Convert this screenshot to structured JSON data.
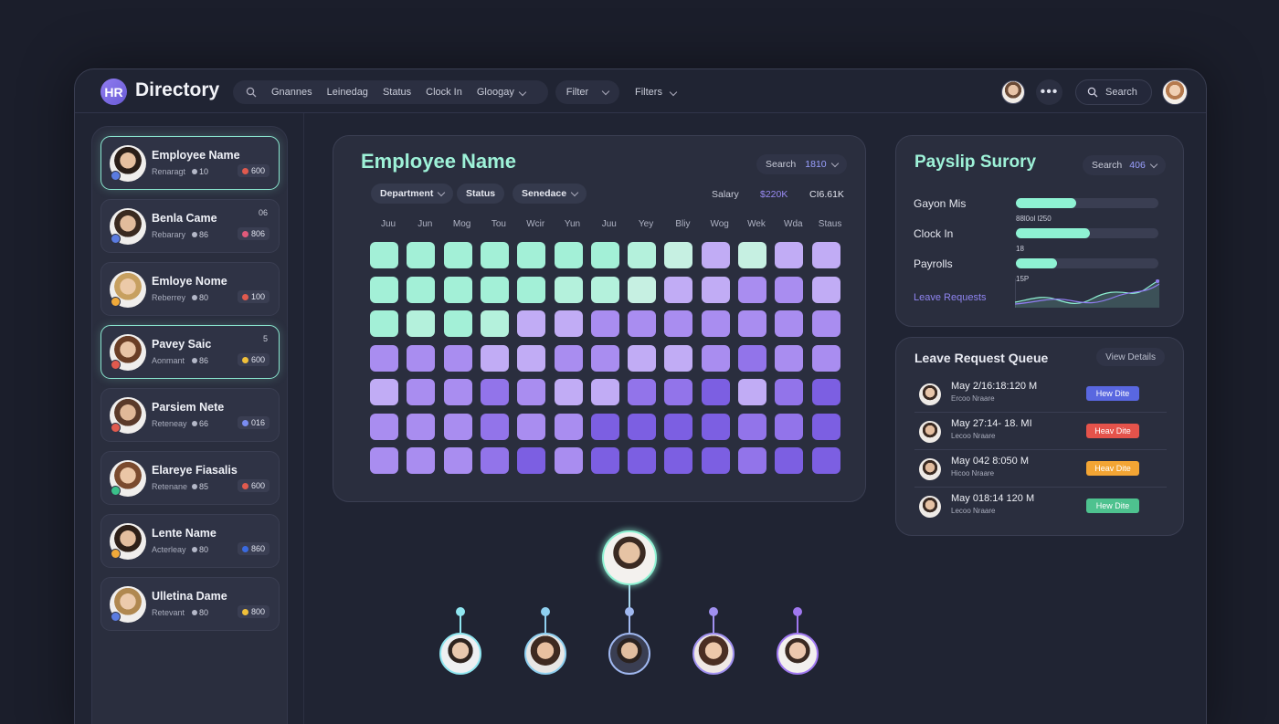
{
  "header": {
    "logo_text": "HR",
    "title": "Directory",
    "nav": [
      "Gnannes",
      "Leinedag",
      "Status",
      "Clock In",
      "Gloogay"
    ],
    "filter_label": "Filter",
    "filters_label": "Filters",
    "search_label": "Search"
  },
  "sidebar": {
    "employees": [
      {
        "name": "Employee Name",
        "role": "Renaragt",
        "count": "10",
        "badge": "600",
        "badge_color": "#e05a4e",
        "dot_color": "#5a7be0",
        "selected": true
      },
      {
        "name": "Benla Came",
        "role": "Rebarary",
        "count": "86",
        "badge": "806",
        "badge_color": "#e05a7a",
        "dot_color": "#5a7be0",
        "corner": "06"
      },
      {
        "name": "Emloye Nome",
        "role": "Reberrey",
        "count": "80",
        "badge": "100",
        "badge_color": "#e05a4e",
        "dot_color": "#f0a93a"
      },
      {
        "name": "Pavey Saic",
        "role": "Aonmant",
        "count": "86",
        "badge": "600",
        "badge_color": "#f0c03a",
        "dot_color": "#e05a4e",
        "corner": "5",
        "selected": true
      },
      {
        "name": "Parsiem Nete",
        "role": "Reteneay",
        "count": "66",
        "badge": "016",
        "badge_color": "#7a8cf0",
        "dot_color": "#e05a4e"
      },
      {
        "name": "Elareye Fiasalis",
        "role": "Retenane",
        "count": "85",
        "badge": "600",
        "badge_color": "#e05a4e",
        "dot_color": "#3ac08a"
      },
      {
        "name": "Lente Name",
        "role": "Acterleay",
        "count": "80",
        "badge": "860",
        "badge_color": "#3a6ae0",
        "dot_color": "#f0a93a"
      },
      {
        "name": "Ulletina Dame",
        "role": "Retevant",
        "count": "80",
        "badge": "800",
        "badge_color": "#f0c03a",
        "dot_color": "#5a7be0"
      }
    ]
  },
  "heatmap": {
    "title": "Employee Name",
    "search_label": "Search",
    "search_value": "1810",
    "pills": [
      "Department",
      "Status",
      "Senedace"
    ],
    "salary_label": "Salary",
    "salary_value": "$220K",
    "salary_value2": "CI6.61K",
    "columns": [
      "Juu",
      "Jun",
      "Mog",
      "Tou",
      "Wcir",
      "Yun",
      "Juu",
      "Yey",
      "Bliy",
      "Wog",
      "Wek",
      "Wda",
      "Staus"
    ],
    "levels": [
      [
        0,
        0,
        0,
        0,
        0,
        0,
        0,
        1,
        2,
        4,
        2,
        4,
        4
      ],
      [
        0,
        0,
        0,
        0,
        0,
        1,
        1,
        2,
        4,
        4,
        5,
        5,
        4
      ],
      [
        0,
        1,
        0,
        1,
        4,
        4,
        5,
        5,
        5,
        5,
        5,
        5,
        5
      ],
      [
        5,
        5,
        5,
        4,
        4,
        5,
        5,
        4,
        4,
        5,
        6,
        5,
        5
      ],
      [
        4,
        5,
        5,
        6,
        5,
        4,
        4,
        6,
        6,
        7,
        4,
        6,
        7
      ],
      [
        5,
        5,
        5,
        6,
        5,
        5,
        7,
        7,
        7,
        7,
        6,
        6,
        7
      ],
      [
        5,
        5,
        5,
        6,
        7,
        5,
        7,
        7,
        7,
        7,
        6,
        7,
        7
      ]
    ],
    "palette": [
      "#a3f0d7",
      "#b4f1dc",
      "#c6f0e2",
      "#c0dcf5",
      "#c1acf5",
      "#a98df0",
      "#9274ea",
      "#7c5fe2"
    ]
  },
  "payslip": {
    "title": "Payslip Surory",
    "search_label": "Search",
    "search_value": "406",
    "rows": [
      {
        "label": "Gayon Mis",
        "value": 0.42,
        "note": "88l0ol l250"
      },
      {
        "label": "Clock In",
        "value": 0.52,
        "note": "18"
      },
      {
        "label": "Payrolls",
        "value": 0.29,
        "note": "15P"
      }
    ],
    "leave_link": "Leave Requests",
    "accent": "#8ef2d3"
  },
  "leave": {
    "title": "Leave Request Queue",
    "view_label": "View Details",
    "rows": [
      {
        "date": "May 2/16:18:120 M",
        "name": "Ercoo Nraare",
        "badge": "Hew Dite",
        "badge_color": "#5967e0"
      },
      {
        "date": "May 27:14- 18. MI",
        "name": "Lecoo Nraare",
        "badge": "Heav Dite",
        "badge_color": "#e5534b"
      },
      {
        "date": "May 042 8:050 M",
        "name": "Hicoo Nraare",
        "badge": "Heav Dite",
        "badge_color": "#f3a534"
      },
      {
        "date": "May 018:14 120 M",
        "name": "Lecoo Nraare",
        "badge": "Hew Dite",
        "badge_color": "#4ec28f"
      }
    ]
  }
}
